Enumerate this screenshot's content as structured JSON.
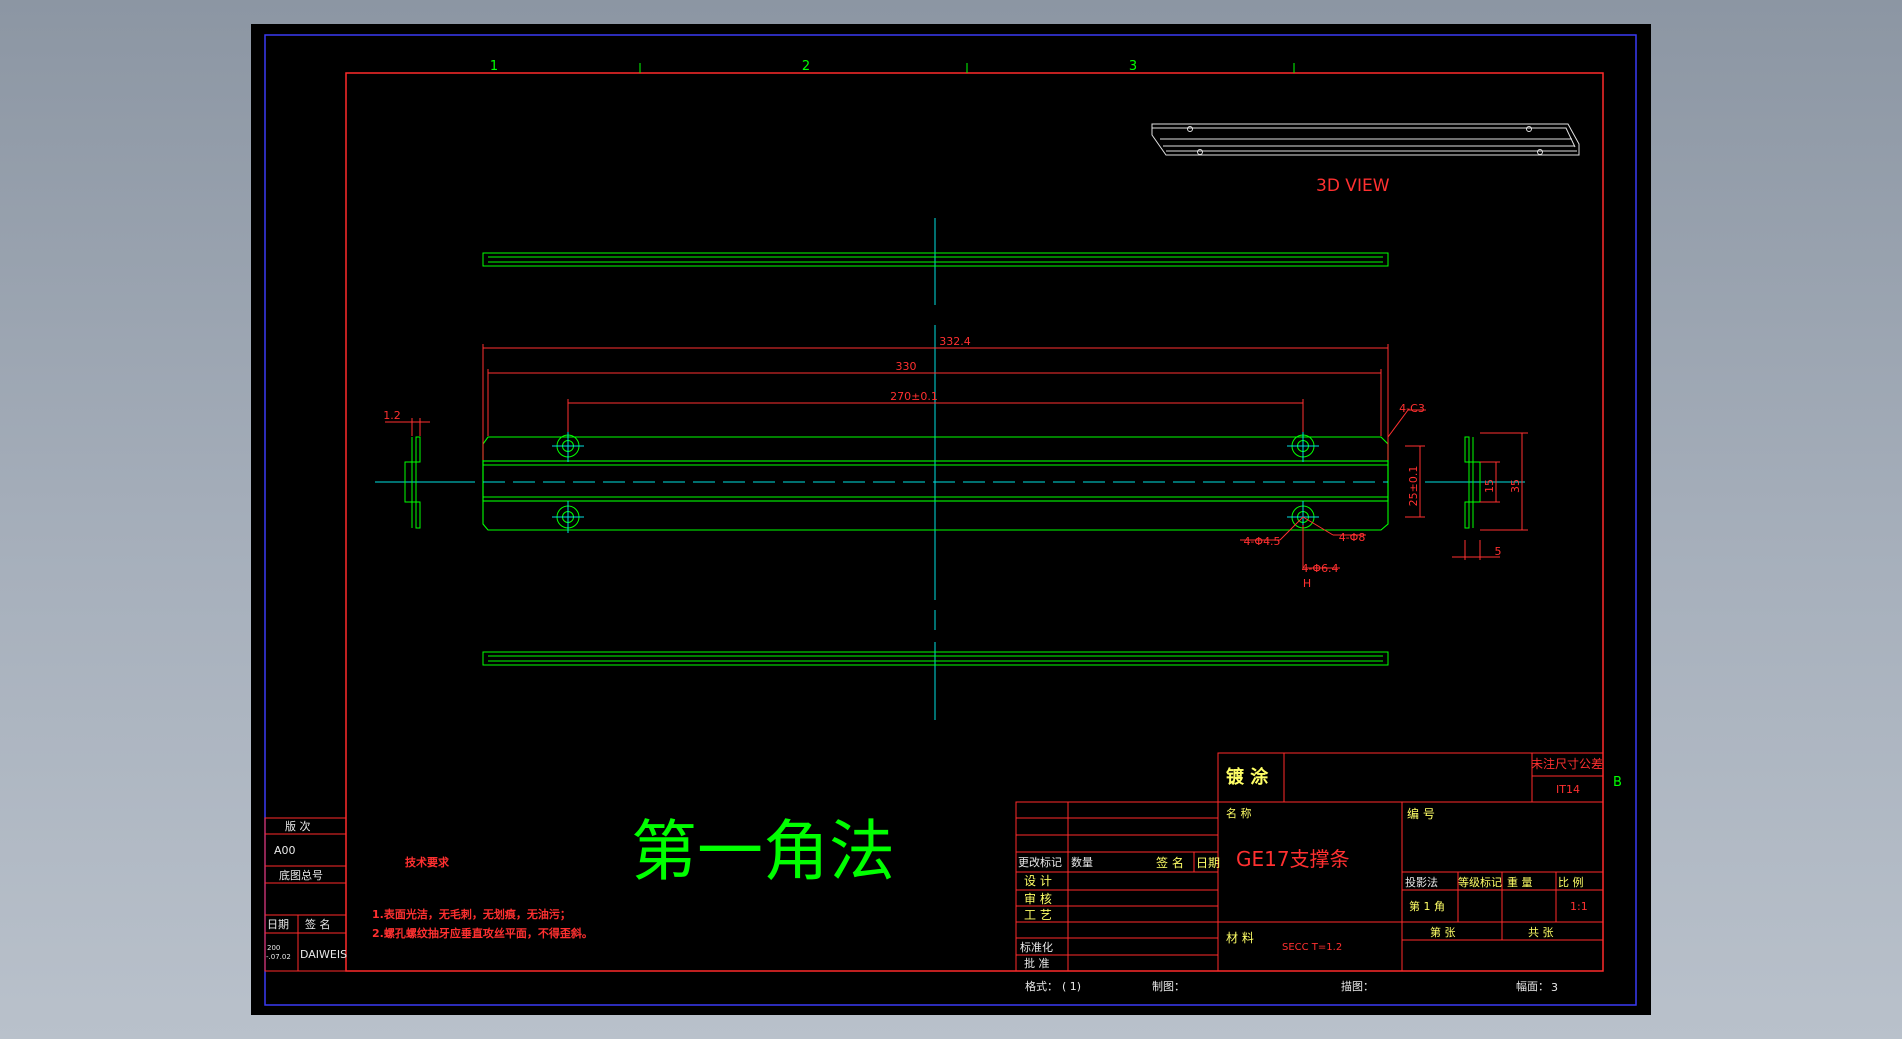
{
  "colors": {
    "background": "#9aa3ae",
    "sheet": "#000000",
    "outer_border": "#3a3af5",
    "frame": "#ff2a2a",
    "part": "#00ff00",
    "centerline": "#00e0e0",
    "dimension": "#ff3030",
    "text_green": "#00ff00",
    "text_yellow": "#ffff66",
    "text_white": "#e8e8e8"
  },
  "zones": [
    "1",
    "2",
    "3"
  ],
  "zone_side": "B",
  "view_3d_label": "3D VIEW",
  "dimensions": {
    "overall": "332.4",
    "length": "330",
    "hole_pitch": "270±0.1",
    "chamfer": "4-C3",
    "thickness": "1.2",
    "width": "25±0.1",
    "side_height": "35",
    "side_small": "15",
    "flange": "5",
    "hole_small": "4-Φ4.5",
    "hole_large": "4-Φ8",
    "hole_depth": "4-Φ6.4",
    "hole_depth_sub": "H"
  },
  "projection_title": "第一角法",
  "tech_requirements": {
    "title": "技术要求",
    "lines": [
      "1.表面光洁，无毛刺，无划痕，无油污；",
      "2.螺孔螺纹抽牙应垂直攻丝平面，不得歪斜。"
    ]
  },
  "revision_block": {
    "version_label": "版  次",
    "version_value": "A00",
    "drawing_no_label": "底图总号",
    "date_label": "日期",
    "sign_label": "签  名",
    "date_value_1": "200",
    "date_value_2": "-.07.02",
    "signer": "DAIWEIS"
  },
  "title_block": {
    "plating_label": "镀 涂",
    "tolerance_label": "未注尺寸公差",
    "tolerance_value": "IT14",
    "name_label": "名  称",
    "part_name": "GE17支撑条",
    "number_label": "编  号",
    "material_label": "材  料",
    "material_value": "SECC T=1.2",
    "change_mark": "更改标记",
    "quantity": "数量",
    "signature": "签  名",
    "date": "日期",
    "design": "设 计",
    "review": "审 核",
    "process": "工 艺",
    "standardization": "标准化",
    "approve": "批 准",
    "projection_label": "投影法",
    "grade_label": "等级标记",
    "weight_label": "重  量",
    "scale_label": "比  例",
    "projection_value": "第 1 角",
    "scale_value": "1:1",
    "sheet_no_label": "第   张",
    "sheet_total_label": "共   张"
  },
  "footer": {
    "format_label": "格式：",
    "format_value": "( 1)",
    "drawn_label": "制图：",
    "traced_label": "描图：",
    "size_label": "幅面：",
    "size_value": "3"
  }
}
